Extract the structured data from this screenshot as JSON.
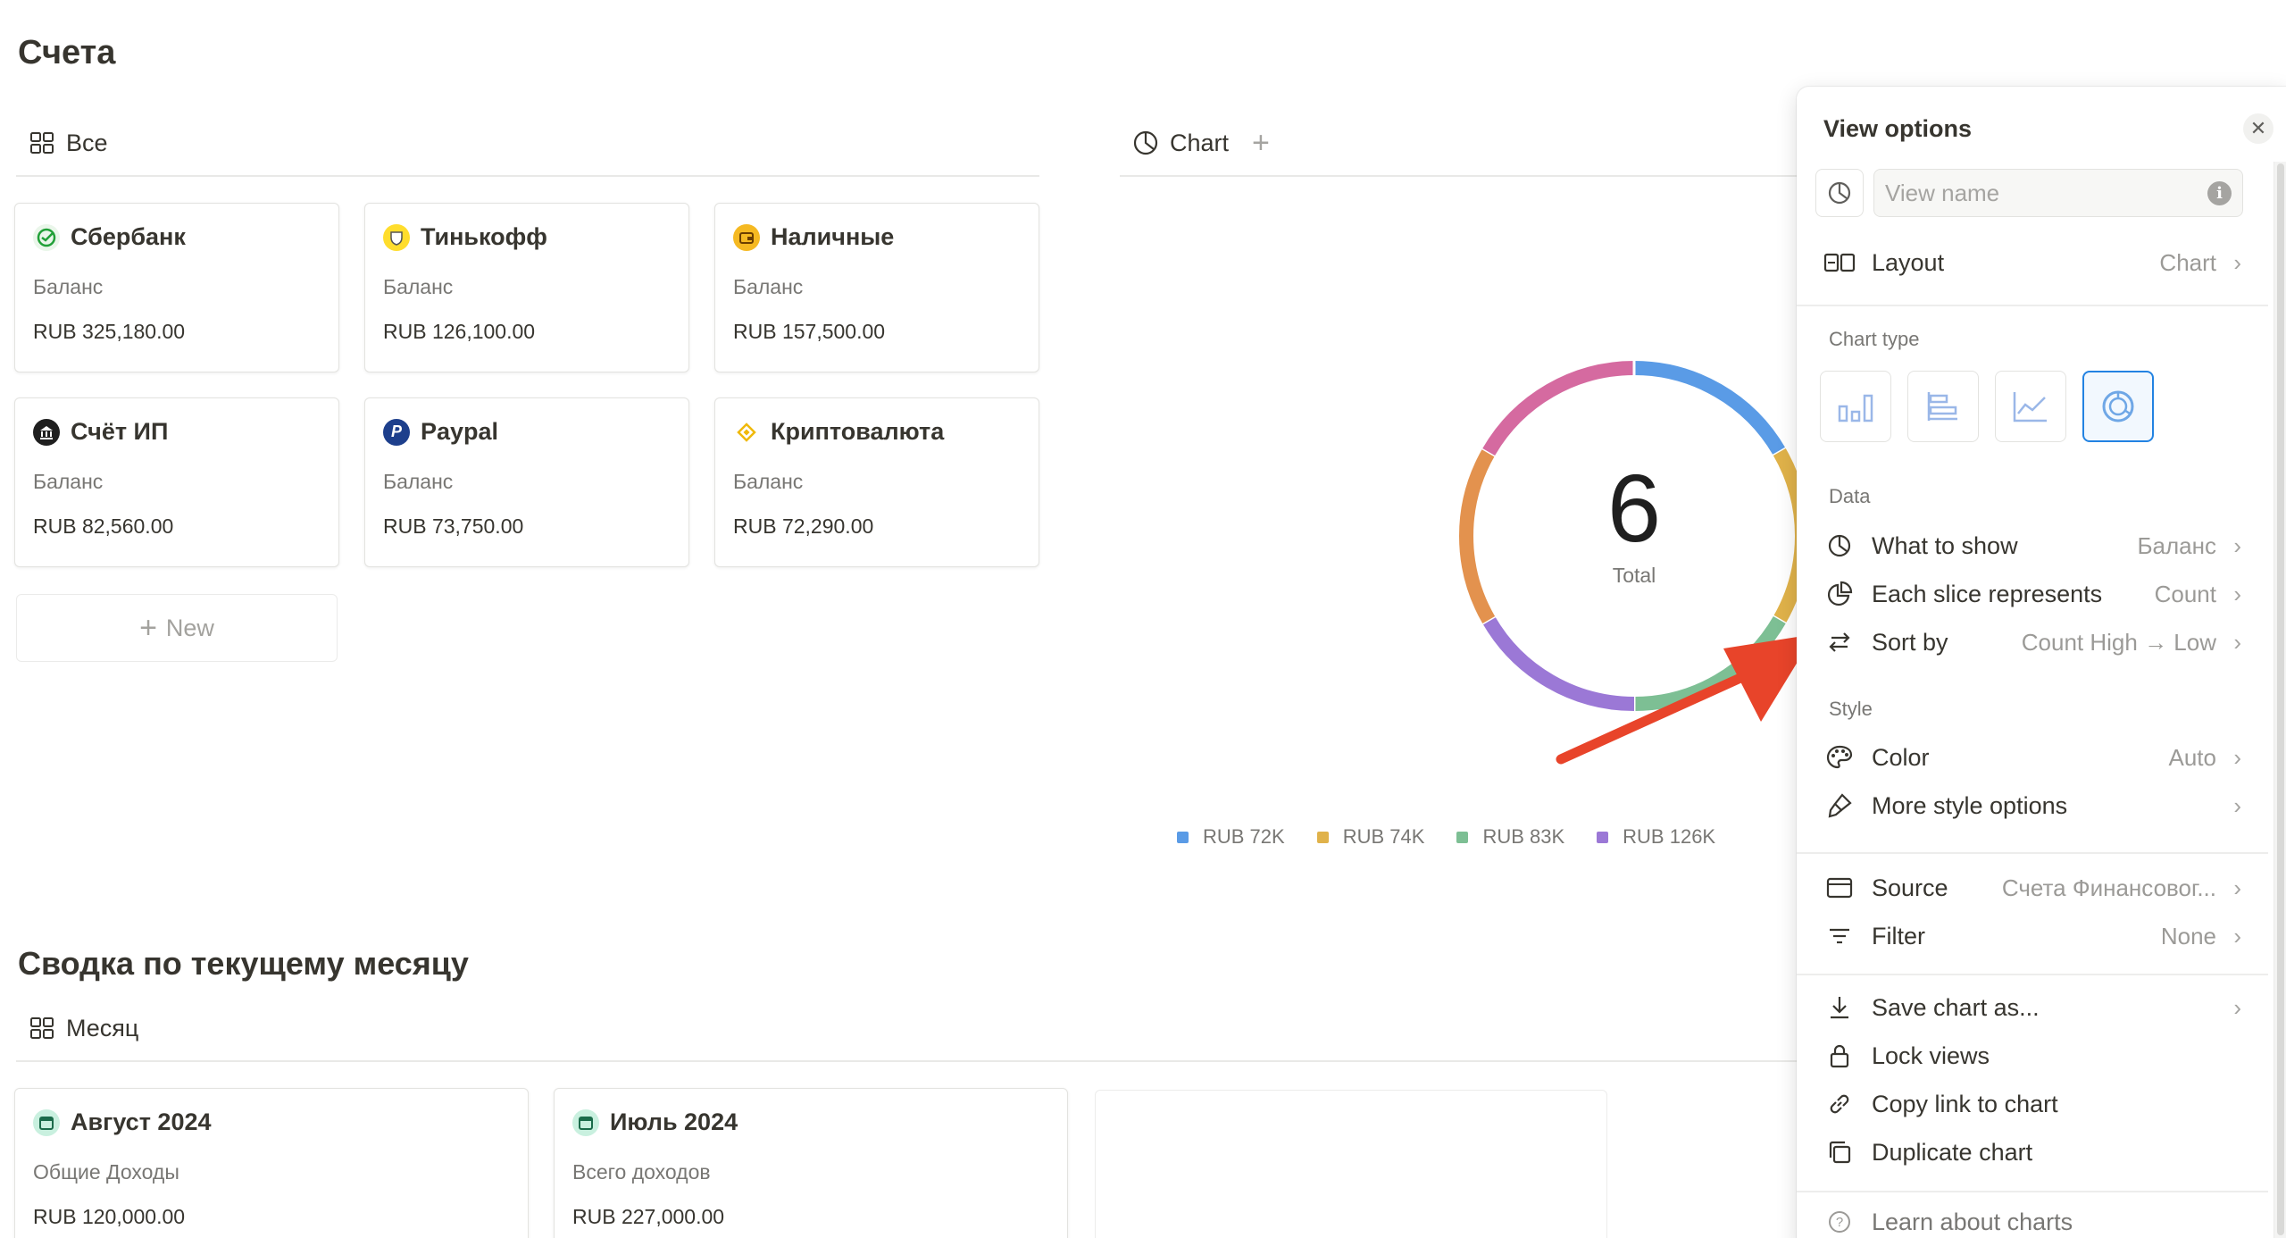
{
  "page": {
    "title": "Счета",
    "section_title": "Сводка по текущему месяцу"
  },
  "tabs": {
    "all": "Все",
    "chart": "Chart",
    "month": "Месяц"
  },
  "accounts": [
    {
      "name": "Сбербанк",
      "label": "Баланс",
      "value": "RUB 325,180.00",
      "icon": "sberbank-icon"
    },
    {
      "name": "Тинькофф",
      "label": "Баланс",
      "value": "RUB 126,100.00",
      "icon": "tinkoff-icon"
    },
    {
      "name": "Наличные",
      "label": "Баланс",
      "value": "RUB 157,500.00",
      "icon": "wallet-icon"
    },
    {
      "name": "Счёт ИП",
      "label": "Баланс",
      "value": "RUB 82,560.00",
      "icon": "bank-icon"
    },
    {
      "name": "Paypal",
      "label": "Баланс",
      "value": "RUB 73,750.00",
      "icon": "paypal-icon"
    },
    {
      "name": "Криптовалюта",
      "label": "Баланс",
      "value": "RUB 72,290.00",
      "icon": "binance-icon"
    }
  ],
  "new_button": "New",
  "months": [
    {
      "name": "Август 2024",
      "label": "Общие Доходы",
      "value": "RUB 120,000.00",
      "icon": "calendar-icon"
    },
    {
      "name": "Июль 2024",
      "label": "Всего доходов",
      "value": "RUB 227,000.00",
      "icon": "calendar-icon"
    }
  ],
  "chart_data": {
    "type": "pie",
    "center_value": "6",
    "center_label": "Total",
    "slices": [
      {
        "label": "RUB 72K",
        "value": 1,
        "color": "#5a9be6"
      },
      {
        "label": "RUB 74K",
        "value": 1,
        "color": "#e0b24a"
      },
      {
        "label": "RUB 83K",
        "value": 1,
        "color": "#7dbf94"
      },
      {
        "label": "RUB 126K",
        "value": 1,
        "color": "#9b78d6"
      },
      {
        "label": "",
        "value": 1,
        "color": "#e3924e"
      },
      {
        "label": "",
        "value": 1,
        "color": "#d56aa0"
      }
    ],
    "legend": [
      "RUB 72K",
      "RUB 74K",
      "RUB 83K",
      "RUB 126K"
    ]
  },
  "panel": {
    "title": "View options",
    "name_placeholder": "View name",
    "layout_label": "Layout",
    "layout_value": "Chart",
    "chart_type_label": "Chart type",
    "data_label": "Data",
    "what_to_show": "What to show",
    "what_to_show_value": "Баланс",
    "each_slice": "Each slice represents",
    "each_slice_value": "Count",
    "sort_by": "Sort by",
    "sort_by_value": "Count High → Low",
    "style_label": "Style",
    "color": "Color",
    "color_value": "Auto",
    "more_style": "More style options",
    "source": "Source",
    "source_value": "Счета Финансовог...",
    "filter": "Filter",
    "filter_value": "None",
    "save_chart": "Save chart as...",
    "lock_views": "Lock views",
    "copy_link": "Copy link to chart",
    "duplicate": "Duplicate chart",
    "learn": "Learn about charts"
  },
  "colors": {
    "accent": "#2383e2",
    "arrow": "#e8442a"
  }
}
